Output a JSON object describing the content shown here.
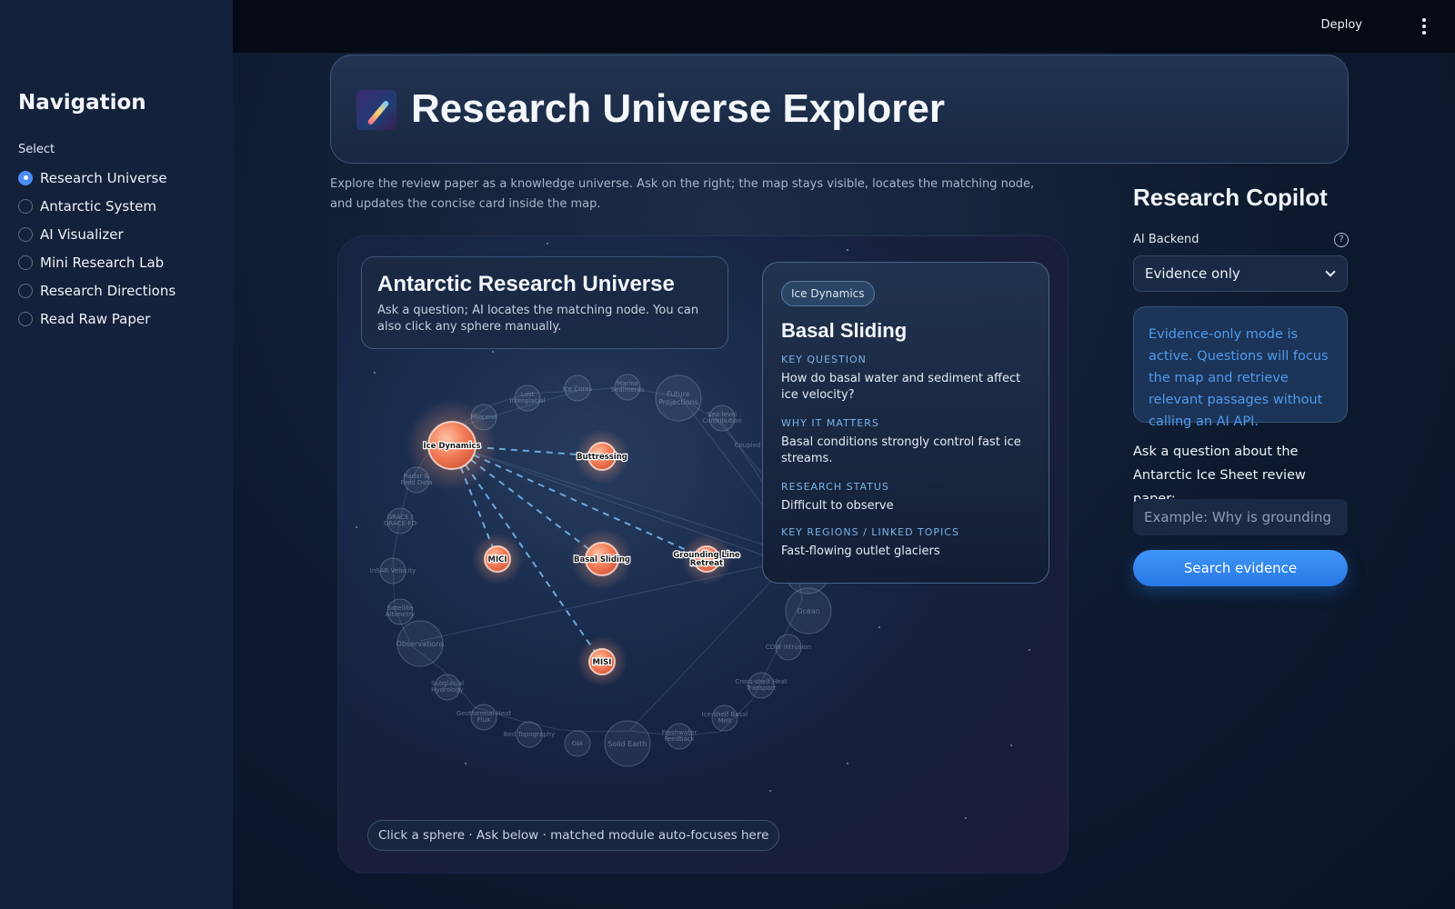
{
  "topbar": {
    "deploy_label": "Deploy",
    "menu_icon": "kebab-icon"
  },
  "sidebar": {
    "title": "Navigation",
    "select_label": "Select",
    "items": [
      {
        "label": "Research Universe",
        "selected": true
      },
      {
        "label": "Antarctic System",
        "selected": false
      },
      {
        "label": "AI Visualizer",
        "selected": false
      },
      {
        "label": "Mini Research Lab",
        "selected": false
      },
      {
        "label": "Research Directions",
        "selected": false
      },
      {
        "label": "Read Raw Paper",
        "selected": false
      }
    ]
  },
  "header": {
    "icon": "shooting-star-icon",
    "title": "Research Universe Explorer"
  },
  "intro": "Explore the review paper as a knowledge universe. Ask on the right; the map stays visible, locates the matching node, and updates the concise card inside the map.",
  "map": {
    "title": "Antarctic Research Universe",
    "subtitle": "Ask a question; AI locates the matching node. You can also click any sphere manually.",
    "hint": "Click a sphere · Ask below · matched module auto-focuses here",
    "active_nodes": [
      "Ice Dynamics",
      "Buttressing",
      "MICI",
      "Basal Sliding",
      "Grounding Line Retreat",
      "MISI"
    ],
    "background_nodes": [
      "Last Interglacial",
      "Ice Cores",
      "Marine Sediments",
      "Future Projections",
      "Sea-level Contribution",
      "Coupled",
      "Pliocene",
      "Radar & Field Data",
      "GRACE / GRACE-FO",
      "InSAR Velocity",
      "Satellite Altimetry",
      "Observations",
      "Subglacial Hydrology",
      "Geothermal Heat Flux",
      "Bed Topography",
      "GIA",
      "Solid Earth",
      "Freshwater Feedback",
      "Ice-shelf Basal Melt",
      "Cross-shelf Heat Transport",
      "CDW Intrusion",
      "Ocean"
    ]
  },
  "card": {
    "tag": "Ice Dynamics",
    "title": "Basal Sliding",
    "sections": [
      {
        "key": "KEY QUESTION",
        "value": "How do basal water and sediment affect ice velocity?"
      },
      {
        "key": "WHY IT MATTERS",
        "value": "Basal conditions strongly control fast ice streams."
      },
      {
        "key": "RESEARCH STATUS",
        "value": "Difficult to observe"
      },
      {
        "key": "KEY REGIONS / LINKED TOPICS",
        "value": "Fast-flowing outlet glaciers"
      }
    ]
  },
  "copilot": {
    "title": "Research Copilot",
    "backend_label": "AI Backend",
    "backend_value": "Evidence only",
    "notice": "Evidence-only mode is active. Questions will focus the map and retrieve relevant passages without calling an AI API.",
    "ask_label": "Ask a question about the Antarctic Ice Sheet review paper:",
    "input_value": "",
    "input_placeholder": "Example: Why is grounding line retreat important?",
    "search_label": "Search evidence"
  },
  "colors": {
    "accent": "#2a78e6",
    "node": "#f2825f",
    "notice_text": "#4e9bef"
  }
}
